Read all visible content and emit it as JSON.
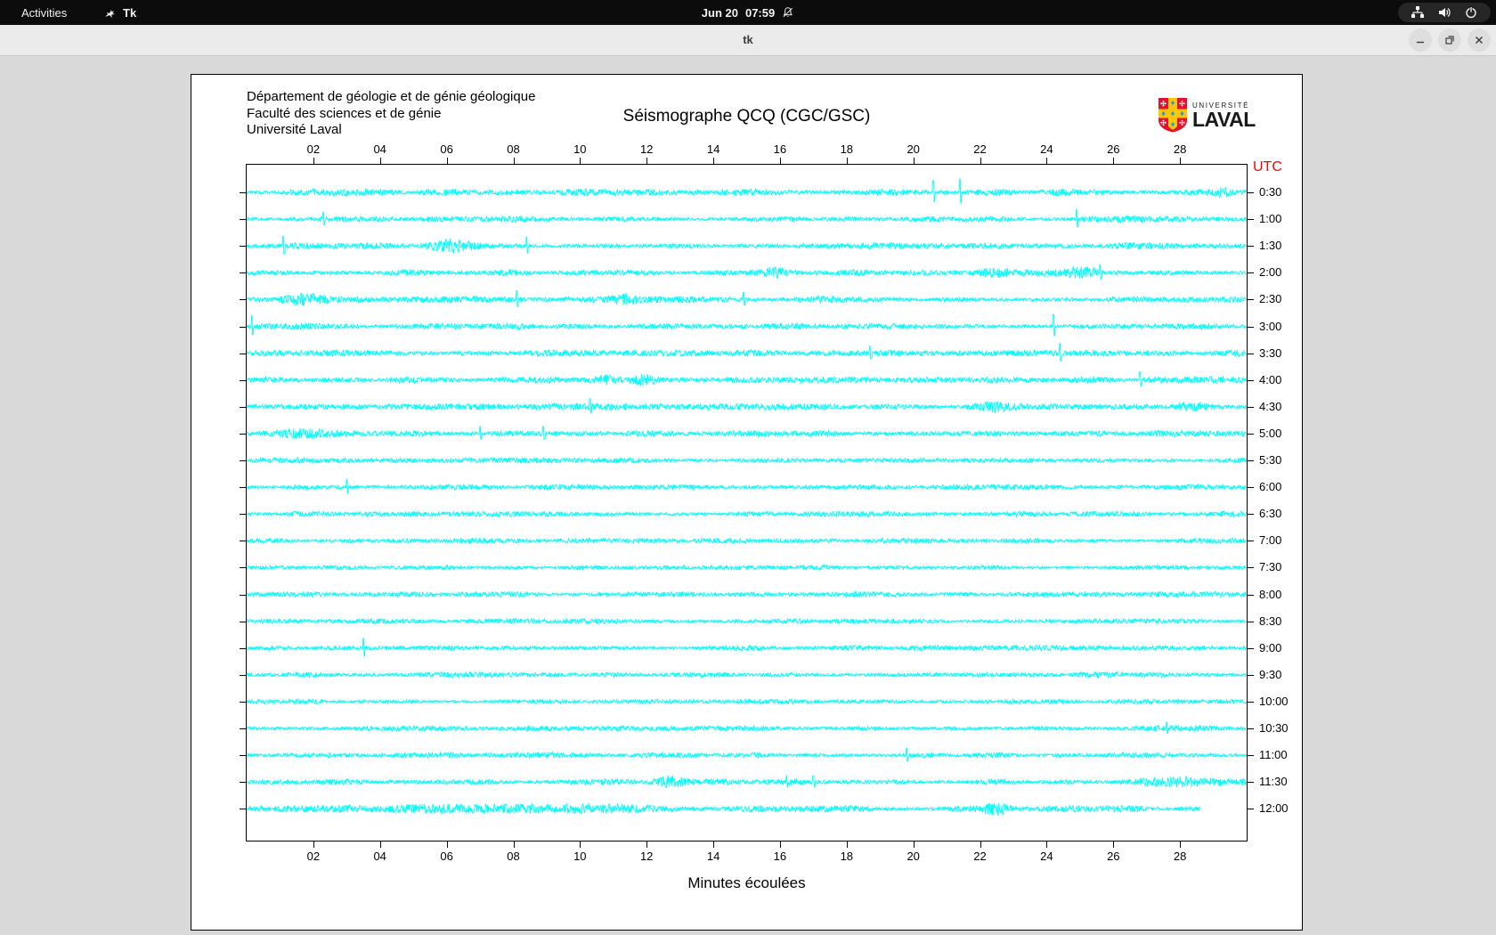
{
  "topbar": {
    "activities": "Activities",
    "app_name": "Tk",
    "clock_date": "Jun 20",
    "clock_time": "07:59"
  },
  "titlebar": {
    "title": "tk"
  },
  "window_controls": {
    "minimize": "minimize",
    "maximize": "restore",
    "close": "close"
  },
  "header": {
    "line1": "Département de géologie et de génie géologique",
    "line2": "Faculté des sciences et de génie",
    "line3": "Université Laval"
  },
  "logo": {
    "small": "UNIVERSITÉ",
    "large": "LAVAL"
  },
  "colors": {
    "trace": "#00ffff",
    "utc_label": "#ff0000",
    "canvas_bg": "#ffffff",
    "tk_bg": "#d9d9d9",
    "logo_red": "#e4112d",
    "logo_gold": "#ffc60b",
    "logo_blue": "#2e9bd6"
  },
  "chart_data": {
    "type": "line",
    "title": "Séismographe QCQ (CGC/GSC)",
    "xlabel": "Minutes écoulées",
    "right_axis_title": "UTC",
    "xlim": [
      0,
      30
    ],
    "x_ticks": [
      "02",
      "04",
      "06",
      "08",
      "10",
      "12",
      "14",
      "16",
      "18",
      "20",
      "22",
      "24",
      "26",
      "28"
    ],
    "grid": false,
    "trace_color": "#00ffff",
    "rows": [
      {
        "label": "0:30",
        "noise": 3.2,
        "spikes": [
          {
            "m": 20.6,
            "a": 13
          },
          {
            "m": 21.4,
            "a": 15
          }
        ],
        "bursts": [
          {
            "m": 29.3,
            "w": 0.25,
            "a": 3
          }
        ]
      },
      {
        "label": "1:00",
        "noise": 3.0,
        "spikes": [
          {
            "m": 2.3,
            "a": 8
          },
          {
            "m": 24.9,
            "a": 11
          }
        ],
        "bursts": []
      },
      {
        "label": "1:30",
        "noise": 3.0,
        "spikes": [
          {
            "m": 1.1,
            "a": 11
          },
          {
            "m": 8.4,
            "a": 10
          }
        ],
        "bursts": [
          {
            "m": 6.2,
            "w": 0.4,
            "a": 5
          }
        ]
      },
      {
        "label": "2:00",
        "noise": 3.0,
        "spikes": [
          {
            "m": 25.6,
            "a": 9
          }
        ],
        "bursts": [
          {
            "m": 15.8,
            "w": 0.35,
            "a": 5
          },
          {
            "m": 22.4,
            "w": 0.3,
            "a": 4
          },
          {
            "m": 25.1,
            "w": 0.3,
            "a": 5
          }
        ]
      },
      {
        "label": "2:30",
        "noise": 3.3,
        "spikes": [
          {
            "m": 8.1,
            "a": 10
          },
          {
            "m": 14.9,
            "a": 8
          }
        ],
        "bursts": [
          {
            "m": 1.7,
            "w": 0.5,
            "a": 5
          },
          {
            "m": 11.3,
            "w": 0.3,
            "a": 4
          }
        ]
      },
      {
        "label": "3:00",
        "noise": 3.0,
        "spikes": [
          {
            "m": 0.15,
            "a": 12
          },
          {
            "m": 24.2,
            "a": 13
          }
        ],
        "bursts": []
      },
      {
        "label": "3:30",
        "noise": 3.0,
        "spikes": [
          {
            "m": 18.7,
            "a": 8
          },
          {
            "m": 24.4,
            "a": 11
          }
        ],
        "bursts": []
      },
      {
        "label": "4:00",
        "noise": 3.0,
        "spikes": [
          {
            "m": 26.8,
            "a": 9
          }
        ],
        "bursts": [
          {
            "m": 10.8,
            "w": 0.3,
            "a": 4
          },
          {
            "m": 11.9,
            "w": 0.25,
            "a": 4
          }
        ]
      },
      {
        "label": "4:30",
        "noise": 3.0,
        "spikes": [
          {
            "m": 10.3,
            "a": 9
          }
        ],
        "bursts": [
          {
            "m": 22.3,
            "w": 0.4,
            "a": 4
          },
          {
            "m": 28.3,
            "w": 0.3,
            "a": 4
          }
        ]
      },
      {
        "label": "5:00",
        "noise": 3.0,
        "spikes": [
          {
            "m": 7.0,
            "a": 8
          },
          {
            "m": 8.9,
            "a": 8
          }
        ],
        "bursts": [
          {
            "m": 1.7,
            "w": 0.5,
            "a": 5
          }
        ]
      },
      {
        "label": "5:30",
        "noise": 2.6,
        "spikes": [],
        "bursts": []
      },
      {
        "label": "6:00",
        "noise": 2.6,
        "spikes": [
          {
            "m": 3.0,
            "a": 9
          }
        ],
        "bursts": []
      },
      {
        "label": "6:30",
        "noise": 2.6,
        "spikes": [],
        "bursts": []
      },
      {
        "label": "7:00",
        "noise": 2.7,
        "spikes": [],
        "bursts": []
      },
      {
        "label": "7:30",
        "noise": 2.3,
        "spikes": [],
        "bursts": []
      },
      {
        "label": "8:00",
        "noise": 2.6,
        "spikes": [],
        "bursts": []
      },
      {
        "label": "8:30",
        "noise": 2.3,
        "spikes": [],
        "bursts": []
      },
      {
        "label": "9:00",
        "noise": 2.6,
        "spikes": [
          {
            "m": 3.5,
            "a": 11
          }
        ],
        "bursts": []
      },
      {
        "label": "9:30",
        "noise": 2.6,
        "spikes": [],
        "bursts": []
      },
      {
        "label": "10:00",
        "noise": 2.3,
        "spikes": [],
        "bursts": []
      },
      {
        "label": "10:30",
        "noise": 2.6,
        "spikes": [
          {
            "m": 27.6,
            "a": 7
          }
        ],
        "bursts": []
      },
      {
        "label": "11:00",
        "noise": 2.6,
        "spikes": [
          {
            "m": 19.8,
            "a": 8
          }
        ],
        "bursts": []
      },
      {
        "label": "11:30",
        "noise": 2.8,
        "spikes": [
          {
            "m": 16.2,
            "a": 7
          },
          {
            "m": 17.0,
            "a": 7
          }
        ],
        "bursts": [
          {
            "m": 12.7,
            "w": 0.3,
            "a": 4
          },
          {
            "m": 27.7,
            "w": 0.8,
            "a": 4
          }
        ]
      },
      {
        "label": "12:00",
        "noise": 3.0,
        "end": 28.6,
        "spikes": [],
        "bursts": [
          {
            "m": 8.0,
            "w": 3.0,
            "a": 3
          },
          {
            "m": 22.5,
            "w": 0.3,
            "a": 5
          }
        ]
      }
    ]
  }
}
